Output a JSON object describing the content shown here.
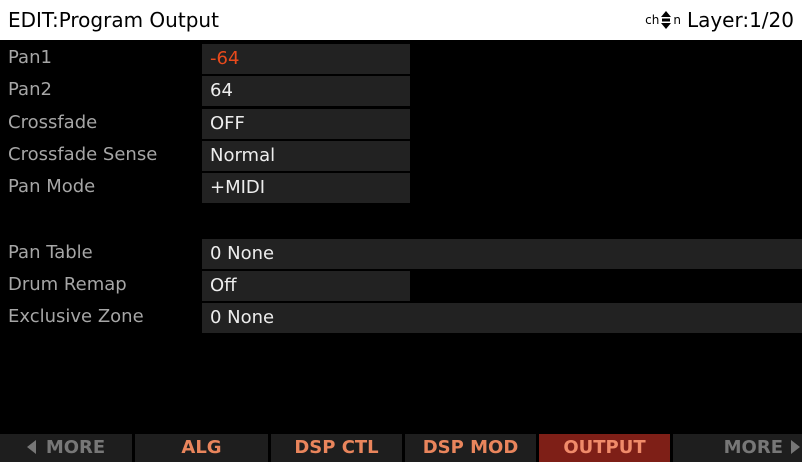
{
  "header": {
    "title": "EDIT:Program Output",
    "chzn_label_left": "ch",
    "chzn_label_right": "n",
    "layer_label": "Layer:1/20"
  },
  "params": [
    {
      "label": "Pan1",
      "value": "-64",
      "box": "short",
      "accent": true
    },
    {
      "label": "Pan2",
      "value": "64",
      "box": "short",
      "accent": false
    },
    {
      "label": "Crossfade",
      "value": "OFF",
      "box": "short",
      "accent": false
    },
    {
      "label": "Crossfade Sense",
      "value": "Normal",
      "box": "short",
      "accent": false
    },
    {
      "label": "Pan Mode",
      "value": "+MIDI",
      "box": "short",
      "accent": false
    },
    {
      "label": "Pan Table",
      "value": "0 None",
      "box": "long",
      "accent": false
    },
    {
      "label": "Drum Remap",
      "value": "Off",
      "box": "short",
      "accent": false
    },
    {
      "label": "Exclusive Zone",
      "value": "0 None",
      "box": "long",
      "accent": false
    }
  ],
  "softkeys": [
    {
      "label": "MORE",
      "state": "more-left"
    },
    {
      "label": "ALG",
      "state": "normal"
    },
    {
      "label": "DSP CTL",
      "state": "normal"
    },
    {
      "label": "DSP MOD",
      "state": "normal"
    },
    {
      "label": "OUTPUT",
      "state": "active"
    },
    {
      "label": "MORE",
      "state": "more-right"
    }
  ],
  "colors": {
    "accent_value": "#e84a1c",
    "active_softkey_bg": "#7e1f17",
    "softkey_text": "#e9855c"
  },
  "icons": {
    "chzn": "chzn-updown-icon",
    "more_left": "triangle-left-icon",
    "more_right": "triangle-right-icon"
  }
}
